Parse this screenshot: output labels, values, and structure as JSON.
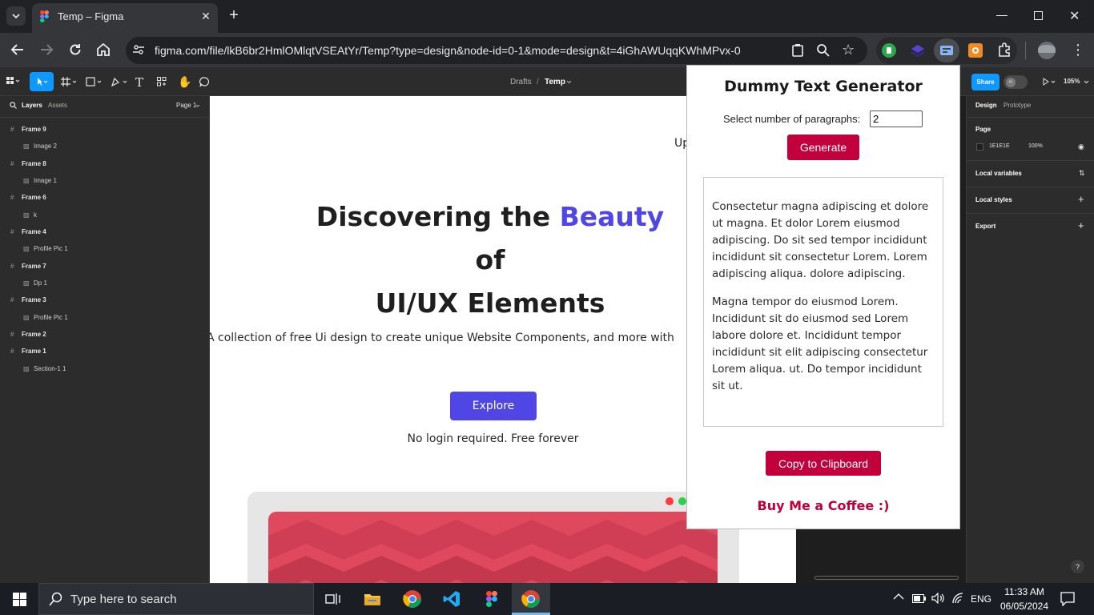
{
  "browser": {
    "tab_title": "Temp – Figma",
    "new_tab_symbol": "+",
    "url": "figma.com/file/lkB6br2HmlOMlqtVSEAtYr/Temp?type=design&node-id=0-1&mode=design&t=4iGhAWUqqKWhMPvx-0"
  },
  "figma": {
    "breadcrumb_drafts": "Drafts",
    "breadcrumb_sep": "/",
    "file_name": "Temp",
    "share_label": "Share",
    "zoom": "105%",
    "left_tabs": {
      "layers": "Layers",
      "assets": "Assets",
      "page": "Page 1"
    },
    "layers": [
      {
        "label": "Frame 9",
        "child": false
      },
      {
        "label": "Image 2",
        "child": true
      },
      {
        "label": "Frame 8",
        "child": false
      },
      {
        "label": "Image 1",
        "child": true
      },
      {
        "label": "Frame 6",
        "child": false
      },
      {
        "label": "k",
        "child": true
      },
      {
        "label": "Frame 4",
        "child": false
      },
      {
        "label": "Profile Pic 1",
        "child": true
      },
      {
        "label": "Frame 7",
        "child": false
      },
      {
        "label": "Dp 1",
        "child": true
      },
      {
        "label": "Frame 3",
        "child": false
      },
      {
        "label": "Profile Pic 1",
        "child": true
      },
      {
        "label": "Frame 2",
        "child": false
      },
      {
        "label": "Frame 1",
        "child": false
      },
      {
        "label": "Section-1 1",
        "child": true
      }
    ],
    "right_panel": {
      "tab_design": "Design",
      "tab_prototype": "Prototype",
      "page_header": "Page",
      "page_color": "1E1E1E",
      "page_opacity": "100%",
      "local_variables": "Local variables",
      "local_styles": "Local styles",
      "export": "Export",
      "help": "?"
    },
    "canvas": {
      "nav_partial": "Up",
      "heading_line1_part1": "Discovering the ",
      "heading_highlight": "Beauty",
      "heading_line2": "of",
      "heading_line3": "UI/UX Elements",
      "subtitle": "A collection of free Ui design  to create unique Website Components, and more with",
      "explore_label": "Explore",
      "note": "No login required. Free forever",
      "accent_color": "#5046e5"
    }
  },
  "popup": {
    "title": "Dummy Text Generator",
    "select_label": "Select number of paragraphs:",
    "paragraph_count": "2",
    "generate_label": "Generate",
    "paragraphs": [
      "Consectetur magna adipiscing et dolore ut magna. Et dolor Lorem eiusmod adipiscing. Do sit sed tempor incididunt incididunt sit consectetur Lorem. Lorem adipiscing aliqua. dolore adipiscing.",
      "Magna tempor do eiusmod Lorem. Incididunt sit do eiusmod sed Lorem labore dolore et. Incididunt tempor incididunt sit elit adipiscing consectetur Lorem aliqua. ut. Do tempor incididunt sit ut."
    ],
    "copy_label": "Copy to Clipboard",
    "coffee_label": "Buy Me a Coffee :)",
    "brand_color": "#c2003b"
  },
  "taskbar": {
    "search_placeholder": "Type here to search",
    "language": "ENG",
    "time": "11:33 AM",
    "date": "06/05/2024"
  }
}
